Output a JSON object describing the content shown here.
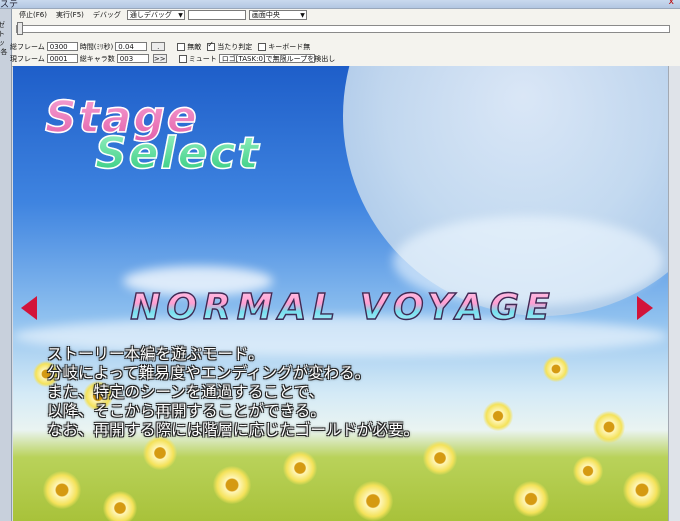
{
  "window": {
    "title": "ステ",
    "close_glyph": "x"
  },
  "left_strip": [
    "ゼ",
    "ト",
    "ッ",
    "-各"
  ],
  "toolbar": {
    "stop_label": "停止(F6)",
    "run_label": "実行(F5)",
    "debug_label": "デバッグ",
    "debug_mode": "通しデバッグ",
    "empty_field": "",
    "view_position": "画面中央"
  },
  "fields": {
    "total_frames_label": "総フレーム",
    "total_frames": "0300",
    "time_label": "時間(ﾐﾘ秒)",
    "time_value": "0.04",
    "dot_button": ".",
    "current_frame_label": "現フレーム",
    "current_frame": "0001",
    "total_chars_label": "総キャラ数",
    "total_chars": "003",
    "forward_button": ">>"
  },
  "options": {
    "invincible_label": "無敵",
    "invincible": false,
    "hitbox_label": "当たり判定",
    "hitbox": true,
    "keyboard_label": "キーボード無",
    "keyboard": false,
    "mute_label": "ミュート",
    "mute": false,
    "loop_detect": "ロゴ[TASK:0]で無限ループを検出し"
  },
  "game": {
    "stage_word1": "Stage",
    "stage_word2": "Select",
    "mode_title": "NORMAL VOYAGE",
    "description": [
      "ストーリー本編を遊ぶモード。",
      "分岐によって難易度やエンディングが変わる。",
      "また、特定のシーンを通過することで、",
      "以降、そこから再開することができる。",
      "なお、再開する際には階層に応じたゴールドが必要。"
    ]
  },
  "colors": {
    "sky_top": "#1e5ec9",
    "stage_pink": "#e25fa9",
    "select_green": "#29c97a",
    "arrow_red": "#d2143a",
    "panel_bg": "#f4f3ee"
  }
}
